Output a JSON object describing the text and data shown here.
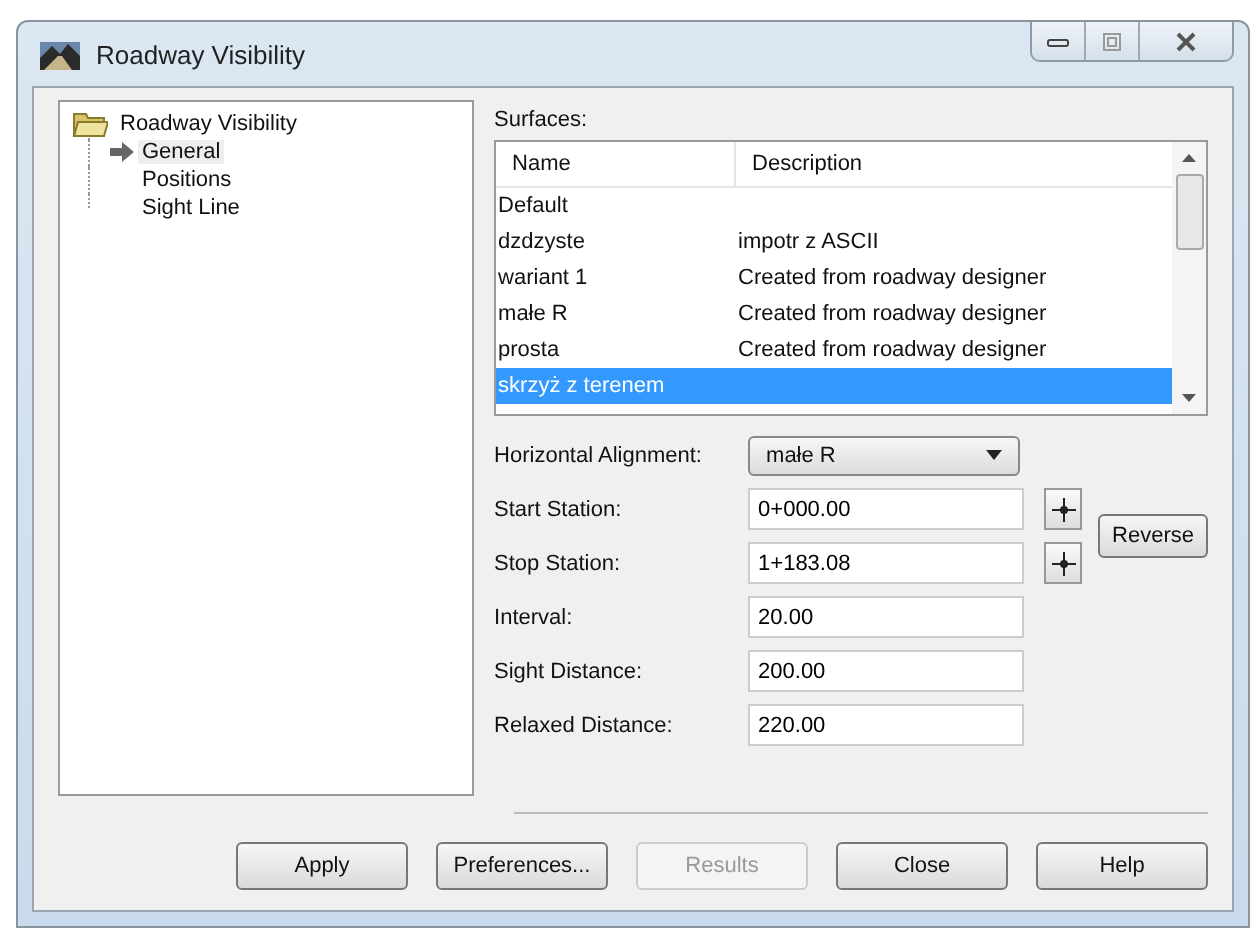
{
  "window": {
    "title": "Roadway Visibility"
  },
  "tree": {
    "label": "Roadway Visibility",
    "selected": false,
    "expanded": true,
    "children": [
      {
        "label": "General",
        "selected": true
      },
      {
        "label": "Positions",
        "selected": false
      },
      {
        "label": "Sight Line",
        "selected": false
      }
    ]
  },
  "surfaces": {
    "label": "Surfaces:",
    "columns": [
      "Name",
      "Description"
    ],
    "rows": [
      {
        "cells": [
          "Default",
          ""
        ],
        "selected": false
      },
      {
        "cells": [
          "dzdzyste",
          "impotr z ASCII"
        ],
        "selected": false
      },
      {
        "cells": [
          "wariant 1",
          "Created from roadway designer"
        ],
        "selected": false
      },
      {
        "cells": [
          "małe R",
          "Created from roadway designer"
        ],
        "selected": false
      },
      {
        "cells": [
          "prosta",
          "Created from roadway designer"
        ],
        "selected": false
      },
      {
        "cells": [
          "skrzyż z terenem",
          ""
        ],
        "selected": true
      }
    ]
  },
  "alignment": {
    "label": "Horizontal Alignment:",
    "value": "małe R"
  },
  "fields": [
    {
      "label": "Start Station:",
      "value": "0+000.00",
      "kind": "station"
    },
    {
      "label": "Stop Station:",
      "value": "1+183.08",
      "kind": "station"
    },
    {
      "label": "Interval:",
      "value": "20.00",
      "kind": "plain"
    },
    {
      "label": "Sight Distance:",
      "value": "200.00",
      "kind": "plain"
    },
    {
      "label": "Relaxed Distance:",
      "value": "220.00",
      "kind": "plain"
    }
  ],
  "reverse_button": "Reverse",
  "buttons": [
    {
      "label": "Apply",
      "disabled": false
    },
    {
      "label": "Preferences...",
      "disabled": false
    },
    {
      "label": "Results",
      "disabled": true
    },
    {
      "label": "Close",
      "disabled": false
    },
    {
      "label": "Help",
      "disabled": false
    }
  ]
}
